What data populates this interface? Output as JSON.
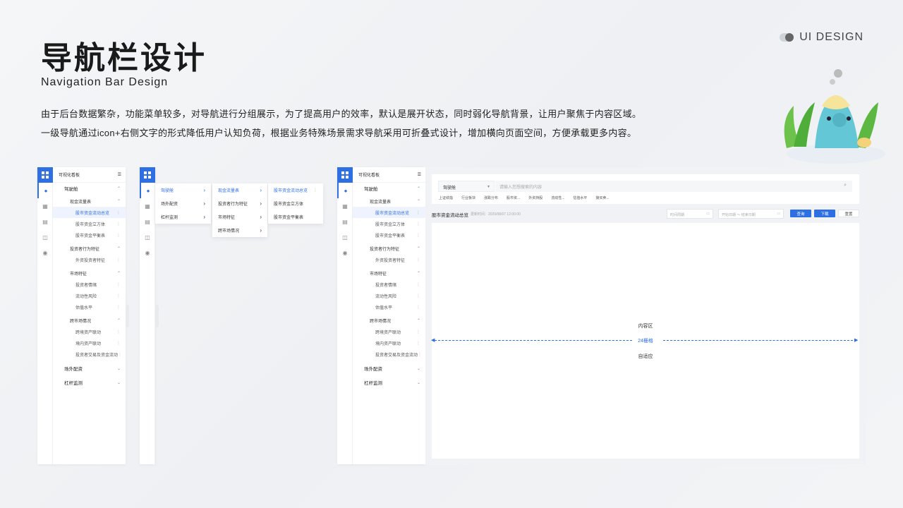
{
  "header": {
    "title_cn": "导航栏设计",
    "title_en": "Navigation Bar Design",
    "desc_line1": "由于后台数据繁杂，功能菜单较多，对导航进行分组展示，为了提高用户的效率，默认是展开状态，同时弱化导航背景，让用户聚焦于内容区域。",
    "desc_line2": "一级导航通过icon+右侧文字的形式降低用户认知负荷，根据业务特殊场景需求导航采用可折叠式设计，增加横向页面空间，方便承载更多内容。",
    "brand": "UI DESIGN"
  },
  "nav": {
    "app_name": "可视化看板",
    "items": [
      {
        "label": "驾驶舱",
        "level": 1,
        "caret": "⌃"
      },
      {
        "label": "现金流量表",
        "level": 2,
        "caret": "⌃"
      },
      {
        "label": "股市资金流动总览",
        "level": 3,
        "selected": true
      },
      {
        "label": "股市资金立方体",
        "level": 3
      },
      {
        "label": "股市资金平衡表",
        "level": 3
      },
      {
        "label": "投资者行为特征",
        "level": 2,
        "caret": "⌃"
      },
      {
        "label": "外资投资者特征",
        "level": 3
      },
      {
        "label": "市场特征",
        "level": 2,
        "caret": "⌃"
      },
      {
        "label": "投资者情绪",
        "level": 3
      },
      {
        "label": "流动性风险",
        "level": 3
      },
      {
        "label": "估值水平",
        "level": 3
      },
      {
        "label": "跨市场情况",
        "level": 2,
        "caret": "⌃"
      },
      {
        "label": "跨境资产联动",
        "level": 3
      },
      {
        "label": "境内资产联动",
        "level": 3
      },
      {
        "label": "投资者交易及资金流动",
        "level": 3
      },
      {
        "label": "场外配资",
        "level": 1,
        "caret": "⌄"
      },
      {
        "label": "杠杆监测",
        "level": 1,
        "caret": "⌄"
      }
    ]
  },
  "flyouts": {
    "col1": [
      "驾驶舱",
      "场外配资",
      "杠杆监测"
    ],
    "col2": [
      "现金流量表",
      "投资者行为特征",
      "市场特征",
      "跨市场情况"
    ],
    "col3": [
      "股市资金流动总览",
      "股市资金立方体",
      "股市资金平衡表"
    ]
  },
  "toolbar": {
    "select": "驾驶舱",
    "search_placeholder": "请输入您想搜索的内容",
    "tags": [
      "上证绩指",
      "行业板块",
      "涨跌分布",
      "股市资...",
      "外资持股",
      "流动性...",
      "估值水平",
      "接买卖..."
    ]
  },
  "page": {
    "title": "股市资金流动总览",
    "updated": "更新时间：2020/08/07 12:00:00",
    "period_placeholder": "时间周期",
    "date_range_placeholder": "开始日期 ～ 结束日期",
    "query_btn": "查询",
    "download_btn": "下载",
    "reset_btn": "重置"
  },
  "content": {
    "label": "内容区",
    "grid": "24栅格",
    "adapt": "自适应"
  },
  "colors": {
    "accent": "#2f6fe4"
  }
}
